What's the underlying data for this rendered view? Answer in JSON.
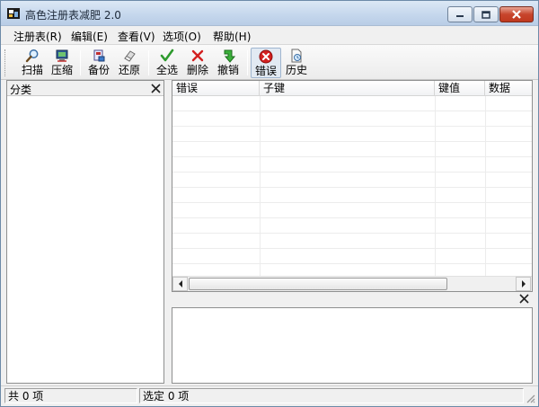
{
  "window": {
    "title": "高色注册表减肥 2.0"
  },
  "menu": [
    {
      "label": "注册表(R)"
    },
    {
      "label": "编辑(E)"
    },
    {
      "label": "查看(V)"
    },
    {
      "label": "选项(O)"
    },
    {
      "label": "帮助(H)"
    }
  ],
  "toolbar": {
    "scan": {
      "label": "扫描",
      "icon": "magnifier-icon"
    },
    "compress": {
      "label": "压缩",
      "icon": "compress-computer-icon"
    },
    "backup": {
      "label": "备份",
      "icon": "backup-icon"
    },
    "restore": {
      "label": "还原",
      "icon": "restore-eraser-icon"
    },
    "select_all": {
      "label": "全选",
      "icon": "checkmark-icon"
    },
    "delete": {
      "label": "删除",
      "icon": "red-x-icon"
    },
    "undo": {
      "label": "撤销",
      "icon": "undo-arrow-icon"
    },
    "errors": {
      "label": "错误",
      "icon": "error-circle-icon"
    },
    "history": {
      "label": "历史",
      "icon": "history-document-icon"
    }
  },
  "left_panel": {
    "title": "分类"
  },
  "grid": {
    "columns": [
      "错误",
      "子键",
      "键值",
      "数据"
    ],
    "rows": []
  },
  "status": {
    "total": "共 0 项",
    "selected": "选定 0 项"
  },
  "colors": {
    "accent_red": "#d32020",
    "accent_green": "#2d9a2d",
    "titlebar": "#c4d6ec"
  }
}
